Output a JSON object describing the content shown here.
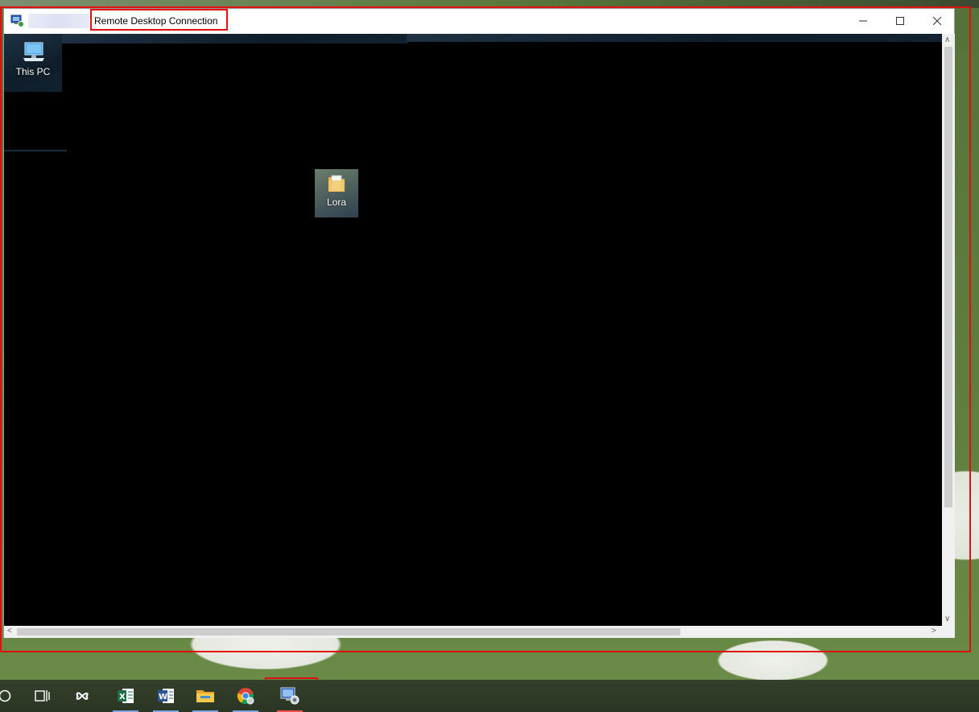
{
  "window": {
    "title": "Remote Desktop Connection"
  },
  "remote_desktop": {
    "icons": [
      {
        "label": "This PC",
        "icon": "computer-icon"
      },
      {
        "label": "Lora",
        "icon": "folder-icon"
      }
    ]
  },
  "taskbar": {
    "items": [
      {
        "name": "search-circle-icon"
      },
      {
        "name": "task-view-icon"
      },
      {
        "name": "pinwheel-app-icon"
      },
      {
        "name": "excel-icon"
      },
      {
        "name": "word-icon"
      },
      {
        "name": "file-explorer-icon"
      },
      {
        "name": "chrome-icon"
      },
      {
        "name": "remote-desktop-icon"
      }
    ]
  },
  "colors": {
    "highlight": "#e01010",
    "taskbar_underline": "#7fa4d9"
  }
}
